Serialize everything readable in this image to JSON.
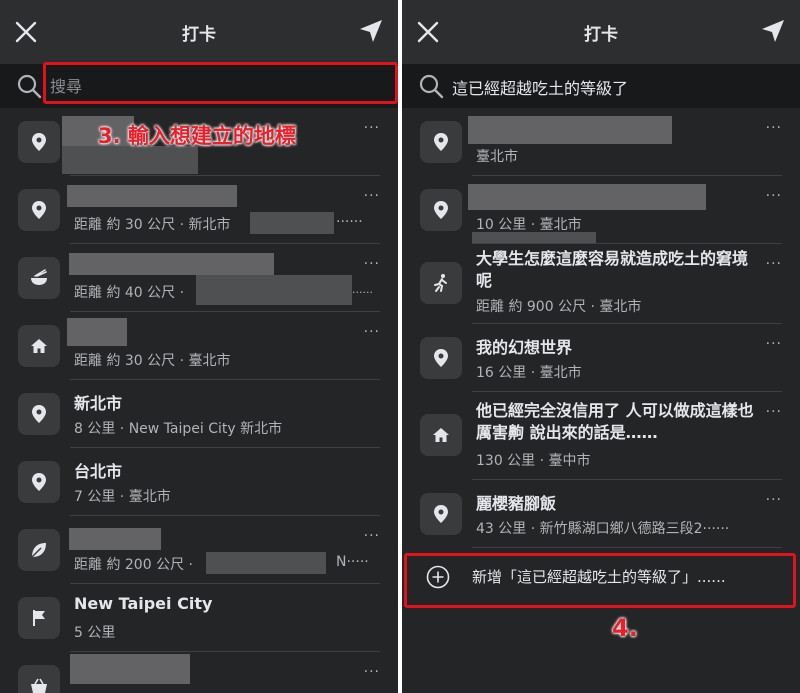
{
  "left": {
    "title": "打卡",
    "search_placeholder": "搜尋",
    "annotation": "3. 輸入想建立的地標",
    "rows": [
      {
        "name": "",
        "sub": ""
      },
      {
        "name": "",
        "sub": "距離 約 30 公尺 · 新北市"
      },
      {
        "name": "",
        "sub": "距離 約 40 公尺 ·"
      },
      {
        "name": "",
        "sub": "距離 約 30 公尺 · 臺北市"
      },
      {
        "name": "新北市",
        "sub": "8 公里 · New Taipei City 新北市"
      },
      {
        "name": "台北市",
        "sub": "7 公里 · 臺北市"
      },
      {
        "name": "",
        "sub": "距離 約 200 公尺 ·"
      },
      {
        "name": "New Taipei City",
        "sub": "5 公里"
      }
    ],
    "trunc_1": "······",
    "trunc_2": "······",
    "trunc_6": "N·····"
  },
  "right": {
    "title": "打卡",
    "search_value": "這已經超越吃土的等級了",
    "rows": [
      {
        "name": "",
        "sub": "臺北市"
      },
      {
        "name": "",
        "sub": "10 公里 · 臺北市"
      },
      {
        "name": "大學生怎麼這麼容易就造成吃土的窘境呢",
        "sub": "距離 約 900 公尺 · 臺北市"
      },
      {
        "name": "我的幻想世界",
        "sub": "16 公里 · 臺北市"
      },
      {
        "name": "他已經完全沒信用了 人可以做成這樣也厲害齁 說出來的話是……",
        "sub": "130 公里 · 臺中市"
      },
      {
        "name": "麗櫻豬腳飯",
        "sub": "43 公里 · 新竹縣湖口鄉八德路三段2······"
      }
    ],
    "add_label": "新增「這已經超越吃土的等級了」......",
    "annotation": "4."
  },
  "more_label": "···",
  "colors": {
    "background": "#242526",
    "highlight": "#e0131c",
    "text": "#e4e6eb",
    "secondary": "#b0b3b8"
  },
  "icons": [
    "close-icon",
    "navigation-arrow-icon",
    "search-icon",
    "map-pin-icon",
    "food-bowl-icon",
    "home-icon",
    "running-person-icon",
    "leaf-icon",
    "flag-icon",
    "shopping-basket-icon",
    "add-circle-icon"
  ]
}
